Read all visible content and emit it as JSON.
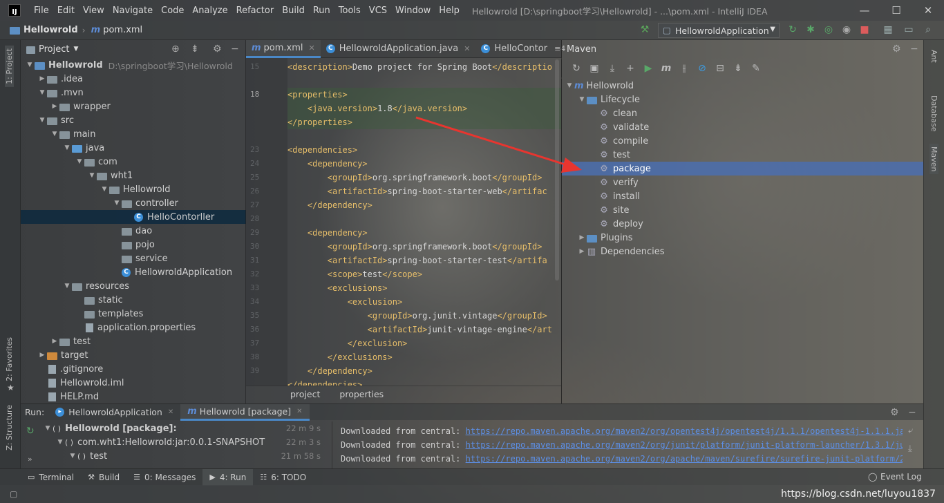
{
  "app": {
    "menu": [
      "File",
      "Edit",
      "View",
      "Navigate",
      "Code",
      "Analyze",
      "Refactor",
      "Build",
      "Run",
      "Tools",
      "VCS",
      "Window",
      "Help"
    ],
    "window_title": "Hellowrold [D:\\springboot学习\\Hellowrold] - ...\\pom.xml - IntelliJ IDEA",
    "logo_text": "IJ",
    "window_controls": {
      "minimize": "—",
      "maximize": "☐",
      "close": "✕"
    }
  },
  "navbar": {
    "project": "Hellowrold",
    "file": "pom.xml",
    "run_config": "HellowroldApplication"
  },
  "left_strip": {
    "project_tab": "1: Project",
    "favorites_tab": "2: Favorites",
    "structure_tab": "Z: Structure"
  },
  "right_strip": {
    "ant_tab": "Ant",
    "database_tab": "Database",
    "maven_tab": "Maven"
  },
  "project_panel": {
    "title": "Project",
    "tree": [
      {
        "label": "Hellowrold",
        "extra": "D:\\springboot学习\\Hellowrold",
        "type": "module",
        "expanded": true,
        "depth": 0,
        "bold": true
      },
      {
        "label": ".idea",
        "type": "folder",
        "expanded": false,
        "depth": 1
      },
      {
        "label": ".mvn",
        "type": "folder",
        "expanded": true,
        "depth": 1
      },
      {
        "label": "wrapper",
        "type": "folder",
        "expanded": false,
        "depth": 2
      },
      {
        "label": "src",
        "type": "folder",
        "expanded": true,
        "depth": 1
      },
      {
        "label": "main",
        "type": "folder",
        "expanded": true,
        "depth": 2
      },
      {
        "label": "java",
        "type": "src",
        "expanded": true,
        "depth": 3
      },
      {
        "label": "com",
        "type": "folder",
        "expanded": true,
        "depth": 4
      },
      {
        "label": "wht1",
        "type": "folder",
        "expanded": true,
        "depth": 5
      },
      {
        "label": "Hellowrold",
        "type": "folder",
        "expanded": true,
        "depth": 6
      },
      {
        "label": "controller",
        "type": "folder",
        "expanded": true,
        "depth": 7
      },
      {
        "label": "HelloContorller",
        "type": "class",
        "depth": 8,
        "selected": true
      },
      {
        "label": "dao",
        "type": "folder",
        "depth": 7
      },
      {
        "label": "pojo",
        "type": "folder",
        "depth": 7
      },
      {
        "label": "service",
        "type": "folder",
        "depth": 7
      },
      {
        "label": "HellowroldApplication",
        "type": "class",
        "depth": 7
      },
      {
        "label": "resources",
        "type": "folder",
        "expanded": true,
        "depth": 3
      },
      {
        "label": "static",
        "type": "folder",
        "depth": 4
      },
      {
        "label": "templates",
        "type": "folder",
        "depth": 4
      },
      {
        "label": "application.properties",
        "type": "file",
        "depth": 4
      },
      {
        "label": "test",
        "type": "folder",
        "expanded": false,
        "depth": 2
      },
      {
        "label": "target",
        "type": "orange",
        "expanded": false,
        "depth": 1
      },
      {
        "label": ".gitignore",
        "type": "file",
        "depth": 1
      },
      {
        "label": "Hellowrold.iml",
        "type": "file",
        "depth": 1
      },
      {
        "label": "HELP.md",
        "type": "file",
        "depth": 1
      }
    ]
  },
  "editor": {
    "tabs": [
      {
        "label": "pom.xml",
        "kind": "maven",
        "active": true
      },
      {
        "label": "HellowroldApplication.java",
        "kind": "class",
        "active": false
      },
      {
        "label": "HelloContor",
        "kind": "class",
        "active": false
      }
    ],
    "tab_overflow": "≡4",
    "line_numbers": [
      "15",
      "",
      "18",
      "",
      "",
      "",
      "23",
      "24",
      "25",
      "26",
      "27",
      "28",
      "29",
      "30",
      "31",
      "32",
      "33",
      "34",
      "35",
      "36",
      "37",
      "38",
      "39"
    ],
    "current_line": "18",
    "lines": [
      "<description>Demo project for Spring Boot</descriptio",
      "",
      "<properties>",
      "    <java.version>1.8</java.version>",
      "</properties>",
      "",
      "<dependencies>",
      "    <dependency>",
      "        <groupId>org.springframework.boot</groupId>",
      "        <artifactId>spring-boot-starter-web</artifac",
      "    </dependency>",
      "",
      "    <dependency>",
      "        <groupId>org.springframework.boot</groupId>",
      "        <artifactId>spring-boot-starter-test</artifa",
      "        <scope>test</scope>",
      "        <exclusions>",
      "            <exclusion>",
      "                <groupId>org.junit.vintage</groupId>",
      "                <artifactId>junit-vintage-engine</art",
      "            </exclusion>",
      "        </exclusions>",
      "    </dependency>",
      "</dependencies>"
    ],
    "breadcrumbs": [
      "project",
      "properties"
    ]
  },
  "maven": {
    "title": "Maven",
    "tree": [
      {
        "label": "Hellowrold",
        "depth": 0,
        "expanded": true,
        "kind": "project"
      },
      {
        "label": "Lifecycle",
        "depth": 1,
        "expanded": true,
        "kind": "folder"
      },
      {
        "label": "clean",
        "depth": 2,
        "kind": "goal"
      },
      {
        "label": "validate",
        "depth": 2,
        "kind": "goal"
      },
      {
        "label": "compile",
        "depth": 2,
        "kind": "goal"
      },
      {
        "label": "test",
        "depth": 2,
        "kind": "goal"
      },
      {
        "label": "package",
        "depth": 2,
        "kind": "goal",
        "selected": true
      },
      {
        "label": "verify",
        "depth": 2,
        "kind": "goal"
      },
      {
        "label": "install",
        "depth": 2,
        "kind": "goal"
      },
      {
        "label": "site",
        "depth": 2,
        "kind": "goal"
      },
      {
        "label": "deploy",
        "depth": 2,
        "kind": "goal"
      },
      {
        "label": "Plugins",
        "depth": 1,
        "expanded": false,
        "kind": "folder"
      },
      {
        "label": "Dependencies",
        "depth": 1,
        "expanded": false,
        "kind": "deps"
      }
    ]
  },
  "run": {
    "label": "Run:",
    "tabs": [
      {
        "label": "HellowroldApplication",
        "active": false
      },
      {
        "label": "Hellowrold [package]",
        "active": true
      }
    ],
    "tree": [
      {
        "label": "Hellowrold [package]:",
        "time": "22 m 9 s",
        "depth": 0,
        "bold": true
      },
      {
        "label": "com.wht1:Hellowrold:jar:0.0.1-SNAPSHOT",
        "time": "22 m 3 s",
        "depth": 1
      },
      {
        "label": "test",
        "time": "21 m 58 s",
        "depth": 2
      }
    ],
    "log": [
      {
        "prefix": "Downloaded from central: ",
        "url": "https://repo.maven.apache.org/maven2/org/opentest4j/opentest4j/1.1.1/opentest4j-1.1.1.jar",
        "suffix": " (7"
      },
      {
        "prefix": "Downloaded from central: ",
        "url": "https://repo.maven.apache.org/maven2/org/junit/platform/junit-platform-launcher/1.3.1/junit-",
        "suffix": ""
      },
      {
        "prefix": "Downloaded from central: ",
        "url": "https://repo.maven.apache.org/maven2/org/apache/maven/surefire/surefire-junit-platform/2.2",
        "suffix": ""
      }
    ]
  },
  "bottom_tabs": [
    {
      "label": "Terminal",
      "icon": "terminal-icon",
      "active": false
    },
    {
      "label": "Build",
      "icon": "hammer-icon",
      "active": false
    },
    {
      "label": "0: Messages",
      "icon": "messages-icon",
      "active": false
    },
    {
      "label": "4: Run",
      "icon": "run-icon",
      "active": true
    },
    {
      "label": "6: TODO",
      "icon": "todo-icon",
      "active": false
    }
  ],
  "event_log": "Event Log",
  "watermark": "https://blog.csdn.net/luyou1837",
  "colors": {
    "accent": "#4a88c7",
    "selection": "#4b6eaf",
    "xml_tag": "#e8bf6a",
    "link": "#5c8fe6",
    "arrow": "#e8352f"
  }
}
